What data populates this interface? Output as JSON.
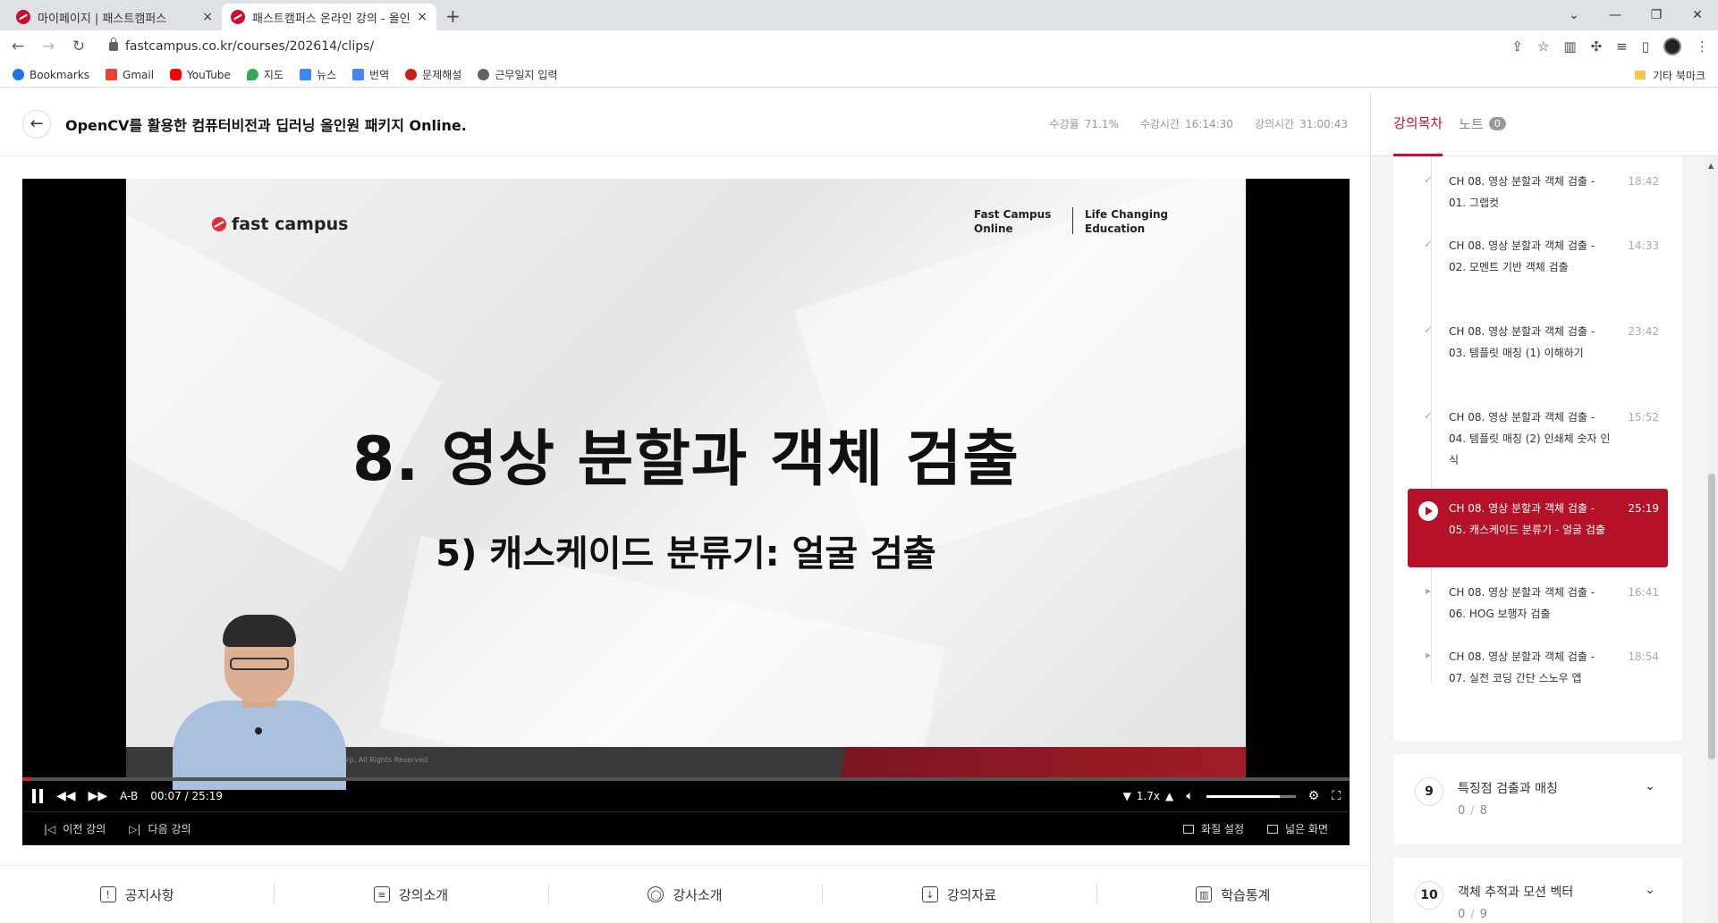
{
  "browser": {
    "tabs": [
      {
        "title": "마이페이지 | 패스트캠퍼스",
        "close": "×"
      },
      {
        "title": "패스트캠퍼스 온라인 강의 - 올인",
        "close": "×"
      }
    ],
    "new_tab": "+",
    "url": "fastcampus.co.kr/courses/202614/clips/",
    "bookmarks": [
      {
        "label": "Bookmarks",
        "color": "#1a73e8"
      },
      {
        "label": "Gmail",
        "color": "#ea4335"
      },
      {
        "label": "YouTube",
        "color": "#ff0000"
      },
      {
        "label": "지도",
        "color": "#34a853"
      },
      {
        "label": "뉴스",
        "color": "#4285f4"
      },
      {
        "label": "번역",
        "color": "#4285f4"
      },
      {
        "label": "문제해설",
        "color": "#c5221f"
      },
      {
        "label": "근무일지 입력",
        "color": "#5f6368"
      }
    ],
    "other_bookmarks": "기타 북마크"
  },
  "course": {
    "title": "OpenCV를 활용한 컴퓨터비전과 딥러닝 올인원 패키지 Online.",
    "stats": [
      {
        "label": "수강률",
        "value": "71.1%"
      },
      {
        "label": "수강시간",
        "value": "16:14:30"
      },
      {
        "label": "강의시간",
        "value": "31:00:43"
      }
    ]
  },
  "slide": {
    "logo": "fast campus",
    "tag1_line1": "Fast Campus",
    "tag1_line2": "Online",
    "tag2_line1": "Life Changing",
    "tag2_line2": "Education",
    "title": "8. 영상 분할과 객체 검출",
    "subtitle": "5) 캐스케이드 분류기: 얼굴 검출",
    "footer": "AMPUS Corp. All Rights Reserved"
  },
  "player": {
    "ab": "A-B",
    "current_time": "00:07",
    "separator": "/",
    "duration": "25:19",
    "speed": "1.7x",
    "progress": 0.005,
    "volume": 0.82,
    "prev_label": "이전 강의",
    "next_label": "다음 강의",
    "quality_label": "화질 설정",
    "wide_label": "넓은 화면"
  },
  "bottom_tabs": [
    {
      "label": "공지사항",
      "icon": "!"
    },
    {
      "label": "강의소개",
      "icon": "≡"
    },
    {
      "label": "강사소개",
      "icon": "◯"
    },
    {
      "label": "강의자료",
      "icon": "↓"
    },
    {
      "label": "학습통계",
      "icon": "▥"
    }
  ],
  "sidebar": {
    "tab_curriculum": "강의목차",
    "tab_notes": "노트",
    "notes_count": "0",
    "lessons": [
      {
        "title": "CH 08. 영상 분할과 객체 검출 - 01. 그랩컷",
        "duration": "18:42",
        "status": "done"
      },
      {
        "title": "CH 08. 영상 분할과 객체 검출 - 02. 모멘트 기반 객체 검출",
        "duration": "14:33",
        "status": "done"
      },
      {
        "title": "CH 08. 영상 분할과 객체 검출 - 03. 템플릿 매칭 (1) 이해하기",
        "duration": "23:42",
        "status": "done"
      },
      {
        "title": "CH 08. 영상 분할과 객체 검출 - 04. 템플릿 매칭 (2) 인쇄체 숫자 인식",
        "duration": "15:52",
        "status": "done"
      },
      {
        "title": "CH 08. 영상 분할과 객체 검출 - 05. 캐스케이드 분류기 - 얼굴 검출",
        "duration": "25:19",
        "status": "current"
      },
      {
        "title": "CH 08. 영상 분할과 객체 검출 - 06. HOG 보행자 검출",
        "duration": "16:41",
        "status": "todo"
      },
      {
        "title": "CH 08. 영상 분할과 객체 검출 - 07. 실전 코딩 간단 스노우 앱",
        "duration": "18:54",
        "status": "todo"
      }
    ],
    "chapters": [
      {
        "num": "9",
        "title": "특징점 검출과 매칭",
        "done": "0",
        "total": "8"
      },
      {
        "num": "10",
        "title": "객체 추적과 모션 벡터",
        "done": "0",
        "total": "9"
      }
    ]
  }
}
